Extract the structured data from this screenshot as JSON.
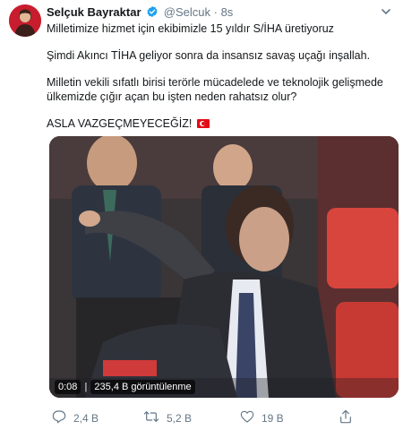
{
  "tweet": {
    "display_name": "Selçuk Bayraktar",
    "handle": "@Selcuk",
    "separator": "·",
    "time": "8s",
    "paragraphs": [
      "Milletimize hizmet için ekibimizle 15 yıldır S/İHA üretiyoruz",
      "Şimdi Akıncı TİHA geliyor sonra da insansız savaş uçağı inşallah.",
      "Milletin vekili sıfatlı birisi terörle mücadelede ve teknolojik gelişmede ülkemizde çığır açan bu işten neden rahatsız olur?",
      "ASLA VAZGEÇMEYECEĞİZ!"
    ],
    "flag_icon": "turkey-flag-emoji"
  },
  "video": {
    "duration": "0:08",
    "views": "235,4 B görüntülenme"
  },
  "actions": {
    "reply_count": "2,4 B",
    "retweet_count": "5,2 B",
    "like_count": "19 B"
  },
  "icons": {
    "verified": "verified-badge-icon",
    "menu": "chevron-down-icon",
    "reply": "reply-icon",
    "retweet": "retweet-icon",
    "like": "heart-icon",
    "share": "share-icon"
  },
  "colors": {
    "verified": "#1da1f2",
    "secondary_text": "#657786",
    "primary_text": "#14171a"
  }
}
